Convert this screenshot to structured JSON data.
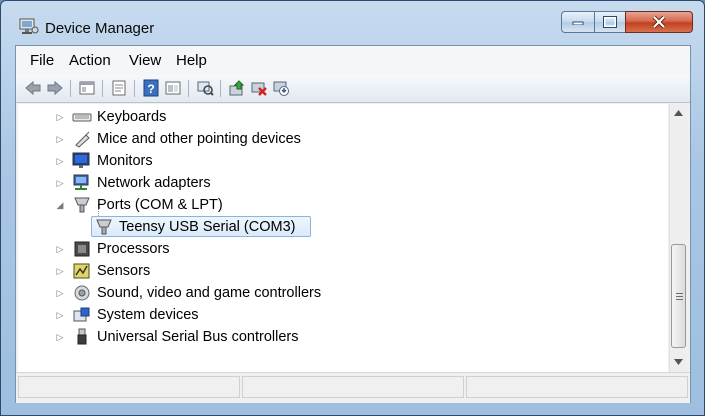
{
  "window": {
    "title": "Device Manager"
  },
  "menu": [
    "File",
    "Action",
    "View",
    "Help"
  ],
  "toolbar": {
    "buttons": [
      "back-icon",
      "forward-icon",
      "up-level-icon",
      "properties-icon",
      "help-icon",
      "show-hidden-icon",
      "scan-hardware-icon",
      "update-driver-icon",
      "uninstall-icon",
      "disable-icon"
    ]
  },
  "tree": {
    "nodes": [
      {
        "label": "Keyboards",
        "icon": "keyboard-icon",
        "expanded": false
      },
      {
        "label": "Mice and other pointing devices",
        "icon": "mouse-icon",
        "expanded": false
      },
      {
        "label": "Monitors",
        "icon": "monitor-icon",
        "expanded": false
      },
      {
        "label": "Network adapters",
        "icon": "network-adapter-icon",
        "expanded": false
      },
      {
        "label": "Ports (COM & LPT)",
        "icon": "port-icon",
        "expanded": true
      },
      {
        "label": "Teensy USB Serial (COM3)",
        "icon": "port-icon",
        "child": true,
        "selected": true
      },
      {
        "label": "Processors",
        "icon": "processor-icon",
        "expanded": false
      },
      {
        "label": "Sensors",
        "icon": "sensor-icon",
        "expanded": false
      },
      {
        "label": "Sound, video and game controllers",
        "icon": "speaker-icon",
        "expanded": false
      },
      {
        "label": "System devices",
        "icon": "system-device-icon",
        "expanded": false
      },
      {
        "label": "Universal Serial Bus controllers",
        "icon": "usb-icon",
        "expanded": false
      }
    ]
  },
  "colors": {
    "selection": "#dbeaf9",
    "selection_border": "#8ab4de",
    "close": "#c2401f"
  }
}
